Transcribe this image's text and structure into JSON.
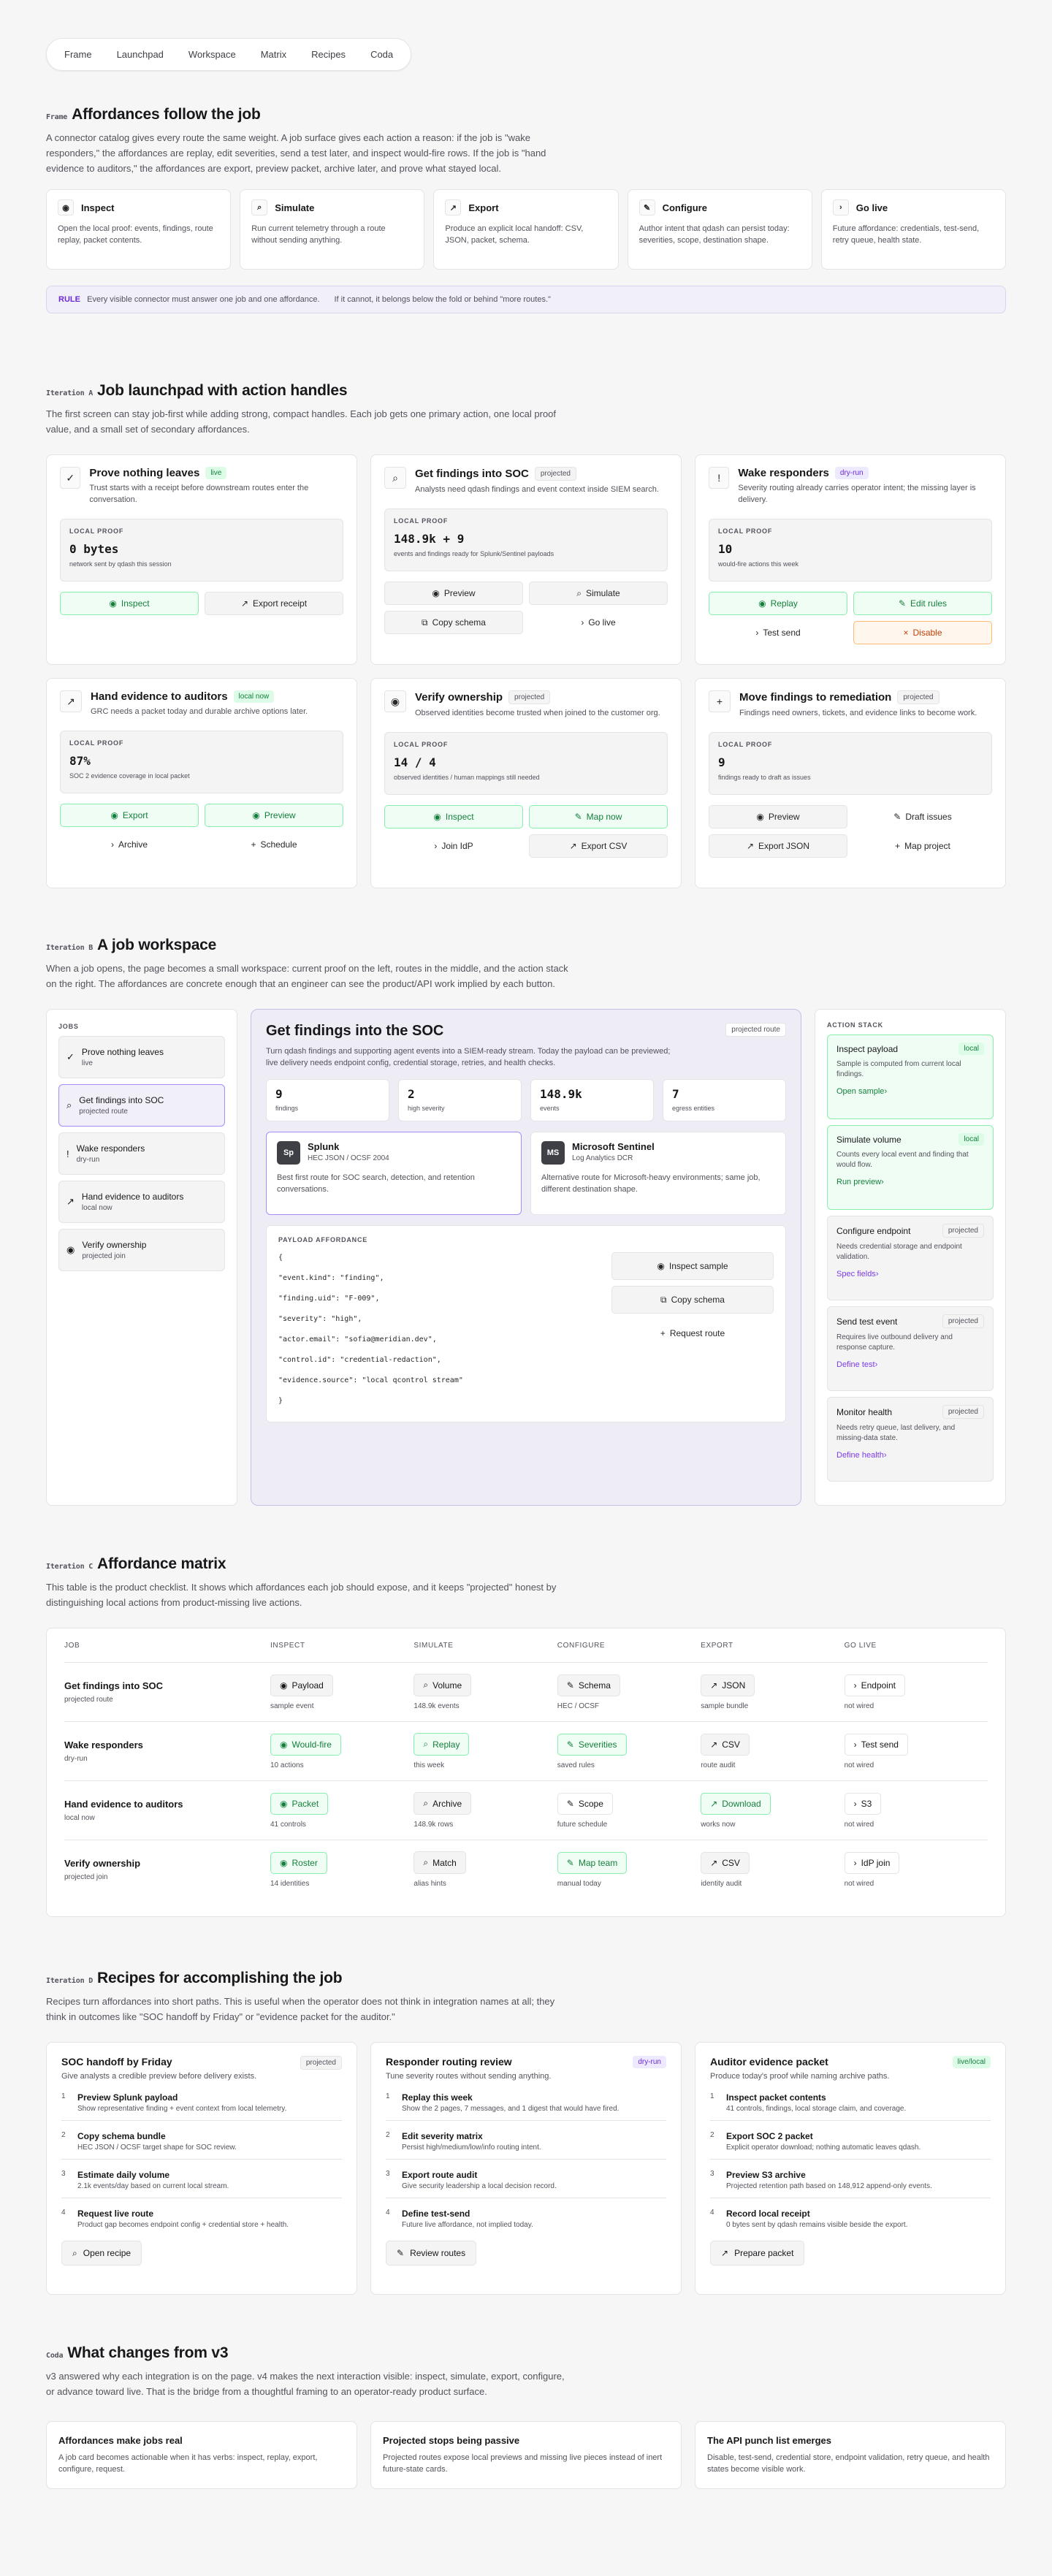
{
  "nav": [
    "Frame",
    "Launchpad",
    "Workspace",
    "Matrix",
    "Recipes",
    "Coda"
  ],
  "frame": {
    "eyebrow": "Frame",
    "title": "Affordances follow the job",
    "lead": "A connector catalog gives every route the same weight. A job surface gives each action a reason: if the job is \"wake responders,\" the affordances are replay, edit severities, send a test later, and inspect would-fire rows. If the job is \"hand evidence to auditors,\" the affordances are export, preview packet, archive later, and prove what stayed local.",
    "cards": [
      {
        "icon": "eye",
        "title": "Inspect",
        "desc": "Open the local proof: events, findings, route replay, packet contents."
      },
      {
        "icon": "search",
        "title": "Simulate",
        "desc": "Run current telemetry through a route without sending anything."
      },
      {
        "icon": "arrow",
        "title": "Export",
        "desc": "Produce an explicit local handoff: CSV, JSON, packet, schema."
      },
      {
        "icon": "pencil",
        "title": "Configure",
        "desc": "Author intent that qdash can persist today: severities, scope, destination shape."
      },
      {
        "icon": "chevron",
        "title": "Go live",
        "desc": "Future affordance: credentials, test-send, retry queue, health state."
      }
    ],
    "rule": {
      "label": "RULE",
      "text1": "Every visible connector must answer one job and one affordance.",
      "text2": "If it cannot, it belongs below the fold or behind \"more routes.\""
    }
  },
  "launchpad": {
    "eyebrow": "Iteration A",
    "title": "Job launchpad with action handles",
    "lead": "The first screen can stay job-first while adding strong, compact handles. Each job gets one primary action, one local proof value, and a small set of secondary affordances.",
    "proof_label": "LOCAL PROOF",
    "cards": [
      {
        "icon": "check",
        "title": "Prove nothing leaves",
        "pill": "live",
        "pill_style": "green",
        "desc": "Trust starts with a receipt before downstream routes enter the conversation.",
        "value": "0 bytes",
        "caption": "network sent by qdash this session",
        "buttons": [
          {
            "l": "Inspect",
            "s": "g",
            "i": "eye"
          },
          {
            "l": "Export receipt",
            "s": "s",
            "i": "arrow"
          }
        ]
      },
      {
        "icon": "search",
        "title": "Get findings into SOC",
        "pill": "projected",
        "pill_style": "gray",
        "desc": "Analysts need qdash findings and event context inside SIEM search.",
        "value": "148.9k + 9",
        "caption": "events and findings ready for Splunk/Sentinel payloads",
        "buttons": [
          {
            "l": "Preview",
            "s": "s",
            "i": "eye"
          },
          {
            "l": "Simulate",
            "s": "s",
            "i": "search"
          },
          {
            "l": "Copy schema",
            "s": "s",
            "i": "copy"
          },
          {
            "l": "Go live",
            "s": "q",
            "i": "chevron"
          }
        ]
      },
      {
        "icon": "bang",
        "title": "Wake responders",
        "pill": "dry-run",
        "pill_style": "purple",
        "desc": "Severity routing already carries operator intent; the missing layer is delivery.",
        "value": "10",
        "caption": "would-fire actions this week",
        "buttons": [
          {
            "l": "Replay",
            "s": "g",
            "i": "eye"
          },
          {
            "l": "Edit rules",
            "s": "g",
            "i": "pencil"
          },
          {
            "l": "Test send",
            "s": "q",
            "i": "chevron"
          },
          {
            "l": "Disable",
            "s": "o",
            "i": "x"
          }
        ]
      },
      {
        "icon": "arrow",
        "title": "Hand evidence to auditors",
        "pill": "local now",
        "pill_style": "green",
        "desc": "GRC needs a packet today and durable archive options later.",
        "value": "87%",
        "caption": "SOC 2 evidence coverage in local packet",
        "buttons": [
          {
            "l": "Export",
            "s": "g",
            "i": "eye"
          },
          {
            "l": "Preview",
            "s": "g",
            "i": "eye"
          },
          {
            "l": "Archive",
            "s": "q",
            "i": "chevron"
          },
          {
            "l": "Schedule",
            "s": "q",
            "i": "plus"
          }
        ]
      },
      {
        "icon": "eye",
        "title": "Verify ownership",
        "pill": "projected",
        "pill_style": "gray",
        "desc": "Observed identities become trusted when joined to the customer org.",
        "value": "14 / 4",
        "caption": "observed identities / human mappings still needed",
        "buttons": [
          {
            "l": "Inspect",
            "s": "g",
            "i": "eye"
          },
          {
            "l": "Map now",
            "s": "g",
            "i": "pencil"
          },
          {
            "l": "Join IdP",
            "s": "q",
            "i": "chevron"
          },
          {
            "l": "Export CSV",
            "s": "s",
            "i": "arrow"
          }
        ]
      },
      {
        "icon": "plus",
        "title": "Move findings to remediation",
        "pill": "projected",
        "pill_style": "gray",
        "desc": "Findings need owners, tickets, and evidence links to become work.",
        "value": "9",
        "caption": "findings ready to draft as issues",
        "buttons": [
          {
            "l": "Preview",
            "s": "s",
            "i": "eye"
          },
          {
            "l": "Draft issues",
            "s": "q",
            "i": "pencil"
          },
          {
            "l": "Export JSON",
            "s": "s",
            "i": "arrow"
          },
          {
            "l": "Map project",
            "s": "q",
            "i": "plus"
          }
        ]
      }
    ]
  },
  "workspace": {
    "eyebrow": "Iteration B",
    "title": "A job workspace",
    "lead": "When a job opens, the page becomes a small workspace: current proof on the left, routes in the middle, and the action stack on the right. The affordances are concrete enough that an engineer can see the product/API work implied by each button.",
    "jobs_label": "JOBS",
    "jobs": [
      {
        "icon": "check",
        "name": "Prove nothing leaves",
        "meta": "live"
      },
      {
        "icon": "search",
        "name": "Get findings into SOC",
        "meta": "projected route",
        "selected": true
      },
      {
        "icon": "bang",
        "name": "Wake responders",
        "meta": "dry-run"
      },
      {
        "icon": "arrow",
        "name": "Hand evidence to auditors",
        "meta": "local now"
      },
      {
        "icon": "eye",
        "name": "Verify ownership",
        "meta": "projected join"
      }
    ],
    "main": {
      "title": "Get findings into the SOC",
      "pill": "projected route",
      "desc": "Turn qdash findings and supporting agent events into a SIEM-ready stream. Today the payload can be previewed; live delivery needs endpoint config, credential storage, retries, and health checks.",
      "stats": [
        {
          "v": "9",
          "l": "findings"
        },
        {
          "v": "2",
          "l": "high severity"
        },
        {
          "v": "148.9k",
          "l": "events"
        },
        {
          "v": "7",
          "l": "egress entities"
        }
      ],
      "routes": [
        {
          "badge": "Sp",
          "name": "Splunk",
          "sub": "HEC JSON / OCSF 2004",
          "desc": "Best first route for SOC search, detection, and retention conversations."
        },
        {
          "badge": "MS",
          "name": "Microsoft Sentinel",
          "sub": "Log Analytics DCR",
          "desc": "Alternative route for Microsoft-heavy environments; same job, different destination shape."
        }
      ],
      "payload_label": "PAYLOAD AFFORDANCE",
      "code": [
        "{",
        "\"event.kind\": \"finding\",",
        "\"finding.uid\": \"F-009\",",
        "\"severity\": \"high\",",
        "\"actor.email\": \"sofia@meridian.dev\",",
        "\"control.id\": \"credential-redaction\",",
        "\"evidence.source\": \"local qcontrol stream\"",
        "}"
      ],
      "payload_buttons": [
        {
          "l": "Inspect sample",
          "i": "eye",
          "s": "s"
        },
        {
          "l": "Copy schema",
          "i": "copy",
          "s": "s"
        },
        {
          "l": "Request route",
          "i": "plus",
          "s": "q"
        }
      ]
    },
    "stack_label": "ACTION STACK",
    "stack": [
      {
        "title": "Inspect payload",
        "pill": "local",
        "g": true,
        "desc": "Sample is computed from current local findings.",
        "link": "Open sample"
      },
      {
        "title": "Simulate volume",
        "pill": "local",
        "g": true,
        "desc": "Counts every local event and finding that would flow.",
        "link": "Run preview"
      },
      {
        "title": "Configure endpoint",
        "pill": "projected",
        "desc": "Needs credential storage and endpoint validation.",
        "link": "Spec fields"
      },
      {
        "title": "Send test event",
        "pill": "projected",
        "desc": "Requires live outbound delivery and response capture.",
        "link": "Define test"
      },
      {
        "title": "Monitor health",
        "pill": "projected",
        "desc": "Needs retry queue, last delivery, and missing-data state.",
        "link": "Define health"
      }
    ]
  },
  "matrix": {
    "eyebrow": "Iteration C",
    "title": "Affordance matrix",
    "lead": "This table is the product checklist. It shows which affordances each job should expose, and it keeps \"projected\" honest by distinguishing local actions from product-missing live actions.",
    "headers": [
      "JOB",
      "INSPECT",
      "SIMULATE",
      "CONFIGURE",
      "EXPORT",
      "GO LIVE"
    ],
    "rows": [
      {
        "job": "Get findings into SOC",
        "sub": "projected route",
        "cells": [
          {
            "l": "Payload",
            "n": "sample event",
            "s": "s",
            "i": "eye"
          },
          {
            "l": "Volume",
            "n": "148.9k events",
            "s": "s",
            "i": "search"
          },
          {
            "l": "Schema",
            "n": "HEC / OCSF",
            "s": "s",
            "i": "pencil"
          },
          {
            "l": "JSON",
            "n": "sample bundle",
            "s": "s",
            "i": "arrow"
          },
          {
            "l": "Endpoint",
            "n": "not wired",
            "s": "w",
            "i": "chevron"
          }
        ]
      },
      {
        "job": "Wake responders",
        "sub": "dry-run",
        "cells": [
          {
            "l": "Would-fire",
            "n": "10 actions",
            "s": "g",
            "i": "eye"
          },
          {
            "l": "Replay",
            "n": "this week",
            "s": "g",
            "i": "search"
          },
          {
            "l": "Severities",
            "n": "saved rules",
            "s": "g",
            "i": "pencil"
          },
          {
            "l": "CSV",
            "n": "route audit",
            "s": "s",
            "i": "arrow"
          },
          {
            "l": "Test send",
            "n": "not wired",
            "s": "w",
            "i": "chevron"
          }
        ]
      },
      {
        "job": "Hand evidence to auditors",
        "sub": "local now",
        "cells": [
          {
            "l": "Packet",
            "n": "41 controls",
            "s": "g",
            "i": "eye"
          },
          {
            "l": "Archive",
            "n": "148.9k rows",
            "s": "s",
            "i": "search"
          },
          {
            "l": "Scope",
            "n": "future schedule",
            "s": "w",
            "i": "pencil"
          },
          {
            "l": "Download",
            "n": "works now",
            "s": "g",
            "i": "arrow"
          },
          {
            "l": "S3",
            "n": "not wired",
            "s": "w",
            "i": "chevron"
          }
        ]
      },
      {
        "job": "Verify ownership",
        "sub": "projected join",
        "cells": [
          {
            "l": "Roster",
            "n": "14 identities",
            "s": "g",
            "i": "eye"
          },
          {
            "l": "Match",
            "n": "alias hints",
            "s": "s",
            "i": "search"
          },
          {
            "l": "Map team",
            "n": "manual today",
            "s": "g",
            "i": "pencil"
          },
          {
            "l": "CSV",
            "n": "identity audit",
            "s": "s",
            "i": "arrow"
          },
          {
            "l": "IdP join",
            "n": "not wired",
            "s": "w",
            "i": "chevron"
          }
        ]
      }
    ]
  },
  "recipes": {
    "eyebrow": "Iteration D",
    "title": "Recipes for accomplishing the job",
    "lead": "Recipes turn affordances into short paths. This is useful when the operator does not think in integration names at all; they think in outcomes like \"SOC handoff by Friday\" or \"evidence packet for the auditor.\"",
    "cards": [
      {
        "title": "SOC handoff by Friday",
        "pill": "projected",
        "pill_style": "gray",
        "desc": "Give analysts a credible preview before delivery exists.",
        "button": "Open recipe",
        "bicon": "search",
        "steps": [
          {
            "t": "Preview Splunk payload",
            "s": "Show representative finding + event context from local telemetry."
          },
          {
            "t": "Copy schema bundle",
            "s": "HEC JSON / OCSF target shape for SOC review."
          },
          {
            "t": "Estimate daily volume",
            "s": "2.1k events/day based on current local stream."
          },
          {
            "t": "Request live route",
            "s": "Product gap becomes endpoint config + credential store + health."
          }
        ]
      },
      {
        "title": "Responder routing review",
        "pill": "dry-run",
        "pill_style": "purple",
        "desc": "Tune severity routes without sending anything.",
        "button": "Review routes",
        "bicon": "pencil",
        "steps": [
          {
            "t": "Replay this week",
            "s": "Show the 2 pages, 7 messages, and 1 digest that would have fired."
          },
          {
            "t": "Edit severity matrix",
            "s": "Persist high/medium/low/info routing intent."
          },
          {
            "t": "Export route audit",
            "s": "Give security leadership a local decision record."
          },
          {
            "t": "Define test-send",
            "s": "Future live affordance, not implied today."
          }
        ]
      },
      {
        "title": "Auditor evidence packet",
        "pill": "live/local",
        "pill_style": "green",
        "desc": "Produce today's proof while naming archive paths.",
        "button": "Prepare packet",
        "bicon": "arrow",
        "steps": [
          {
            "t": "Inspect packet contents",
            "s": "41 controls, findings, local storage claim, and coverage."
          },
          {
            "t": "Export SOC 2 packet",
            "s": "Explicit operator download; nothing automatic leaves qdash."
          },
          {
            "t": "Preview S3 archive",
            "s": "Projected retention path based on 148,912 append-only events."
          },
          {
            "t": "Record local receipt",
            "s": "0 bytes sent by qdash remains visible beside the export."
          }
        ]
      }
    ]
  },
  "coda": {
    "eyebrow": "Coda",
    "title": "What changes from v3",
    "lead": "v3 answered why each integration is on the page. v4 makes the next interaction visible: inspect, simulate, export, configure, or advance toward live. That is the bridge from a thoughtful framing to an operator-ready product surface.",
    "cards": [
      {
        "title": "Affordances make jobs real",
        "desc": "A job card becomes actionable when it has verbs: inspect, replay, export, configure, request."
      },
      {
        "title": "Projected stops being passive",
        "desc": "Projected routes expose local previews and missing live pieces instead of inert future-state cards."
      },
      {
        "title": "The API punch list emerges",
        "desc": "Disable, test-send, credential store, endpoint validation, retry queue, and health states become visible work."
      }
    ]
  }
}
